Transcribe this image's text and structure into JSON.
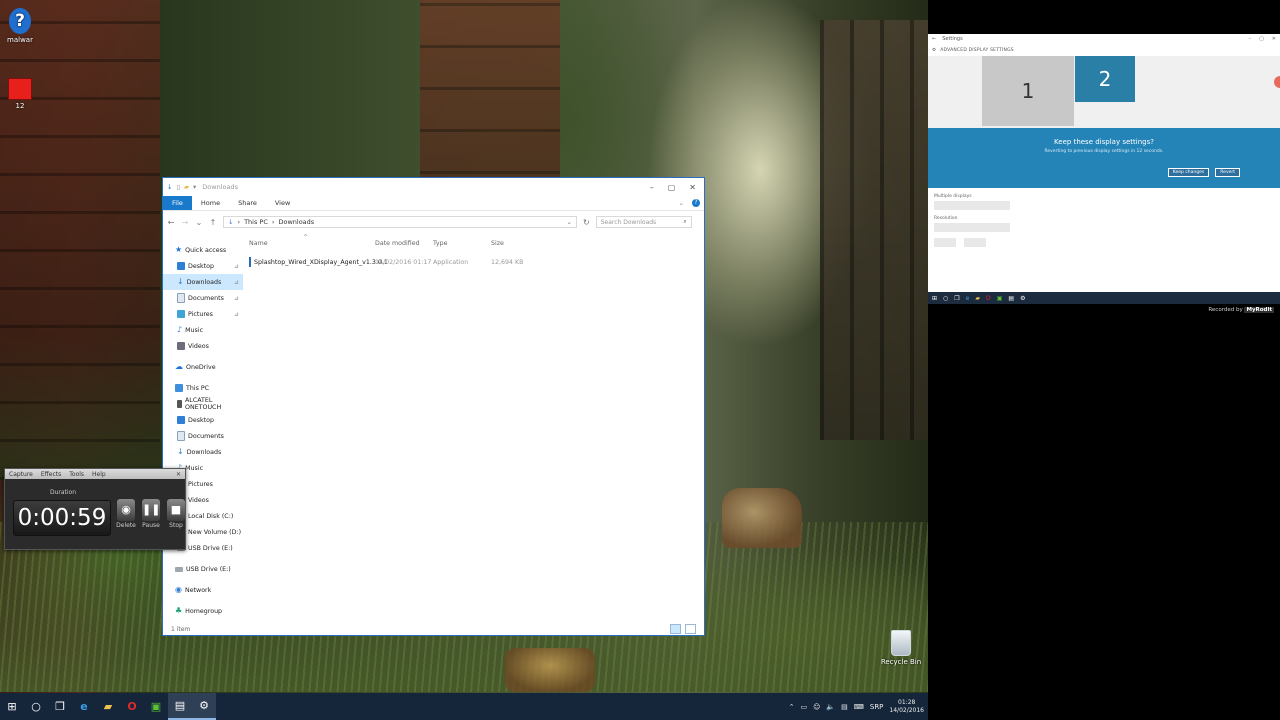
{
  "desktop": {
    "icons": [
      {
        "label": "malwar"
      },
      {
        "label": "12"
      },
      {
        "label": "Recycle Bin"
      }
    ]
  },
  "explorer": {
    "title": "Downloads",
    "ribbon_tabs": [
      "File",
      "Home",
      "Share",
      "View"
    ],
    "breadcrumb": [
      "This PC",
      "Downloads"
    ],
    "search_placeholder": "Search Downloads",
    "nav": {
      "quick_access": "Quick access",
      "quick_items": [
        "Desktop",
        "Downloads",
        "Documents",
        "Pictures",
        "Music",
        "Videos"
      ],
      "onedrive": "OneDrive",
      "this_pc": "This PC",
      "pc_items": [
        "ALCATEL ONETOUCH",
        "Desktop",
        "Documents",
        "Downloads",
        "Music",
        "Pictures",
        "Videos",
        "Local Disk (C:)",
        "New Volume (D:)",
        "USB Drive (E:)"
      ],
      "usb": "USB Drive (E:)",
      "network": "Network",
      "homegroup": "Homegroup"
    },
    "columns": {
      "name": "Name",
      "date": "Date modified",
      "type": "Type",
      "size": "Size"
    },
    "files": [
      {
        "name": "Splashtop_Wired_XDisplay_Agent_v1.3.0.1",
        "date": "14/02/2016 01:17",
        "type": "Application",
        "size": "12,694 KB"
      }
    ],
    "status": "1 item"
  },
  "recorder": {
    "menu": [
      "Capture",
      "Effects",
      "Tools",
      "Help"
    ],
    "duration_label": "Duration",
    "time": "0:00:59",
    "buttons": {
      "delete": "Delete",
      "pause": "Pause",
      "stop": "Stop"
    }
  },
  "taskbar": {
    "lang": "SRP",
    "time": "01:28",
    "date": "14/02/2016"
  },
  "settings": {
    "title": "Settings",
    "header": "ADVANCED DISPLAY SETTINGS",
    "monitor1": "1",
    "monitor2": "2",
    "keep_question": "Keep these display settings?",
    "revert_note": "Reverting to previous display settings in 12 seconds.",
    "keep_button": "Keep changes",
    "revert_button": "Revert",
    "multiple_label": "Multiple displays",
    "resolution_label": "Resolution"
  },
  "watermark": {
    "prefix": "Recorded by",
    "brand": "MyRodlt"
  },
  "colors": {
    "accent": "#1979ca",
    "taskbar": "#15253a",
    "settings_banner": "#2484b8"
  }
}
